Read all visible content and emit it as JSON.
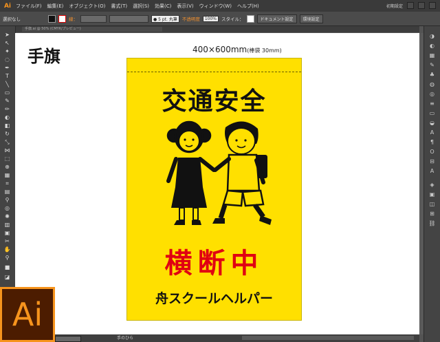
{
  "menubar": {
    "app_logo": "Ai",
    "items": [
      "ファイル(F)",
      "編集(E)",
      "オブジェクト(O)",
      "書式(T)",
      "選択(S)",
      "効果(C)",
      "表示(V)",
      "ウィンドウ(W)",
      "ヘルプ(H)"
    ],
    "workspace": "初期設定"
  },
  "controlbar": {
    "selection_state": "選択なし",
    "stroke_label": "線：",
    "brush": "● 5 pt. 丸筆",
    "opacity_label": "不透明度",
    "opacity_value": "100%",
    "style_label": "スタイル：",
    "doc_settings": "ドキュメント設定",
    "preferences": "環境設定"
  },
  "document": {
    "tab_label": "手旗.ai @ 50% (CMYK/プレビュー)"
  },
  "artboard": {
    "title": "手旗",
    "dimensions": "400×600mm",
    "dimensions_note": "(棒袋 30mm)"
  },
  "flag": {
    "heading": "交通安全",
    "status": "横断中",
    "footer": "舟スクールヘルパー",
    "bg_color": "#ffe000",
    "accent_color": "#e00012"
  },
  "statusbar": {
    "tool_name": "手のひら"
  },
  "brand_logo": "Ai"
}
